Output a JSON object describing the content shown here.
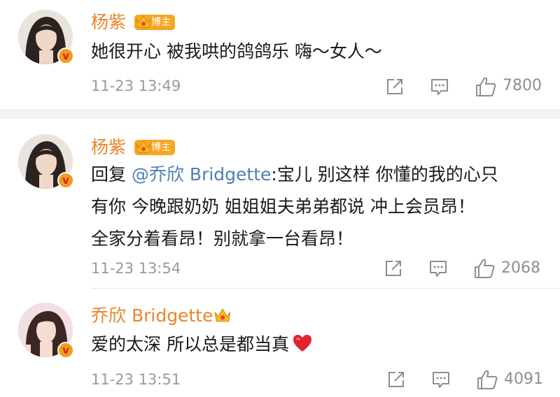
{
  "comments": [
    {
      "user": "杨紫",
      "badge": "博主",
      "text_lines": [
        "她很开心 被我哄的鸽鸽乐 嗨～女人～"
      ],
      "time": "11-23 13:49",
      "likes": "7800"
    },
    {
      "user": "杨紫",
      "badge": "博主",
      "reply_prefix": "回复",
      "mention": "@乔欣 Bridgette",
      "line1_rest": ":宝儿 别这样 你懂的我的心只",
      "line2": "有你 今晚跟奶奶 姐姐姐夫弟弟都说 冲上会员昂！",
      "line3": "全家分着看昂！别就拿一台看昂！",
      "time": "11-23 13:54",
      "likes": "2068"
    },
    {
      "user": "乔欣 Bridgette",
      "text": "爱的太深 所以总是都当真",
      "emoji": "red-heart",
      "time": "11-23 13:51",
      "likes": "4091"
    }
  ],
  "colors": {
    "username": "#e8852c",
    "mention": "#4f7fb5",
    "badge_bg": "#f6a623",
    "verify_badge": "#f29c1f",
    "meta_text": "#9a9a9a"
  },
  "icons": [
    "share-icon",
    "comment-icon",
    "like-icon",
    "crown-icon",
    "verified-badge-icon",
    "heart-icon"
  ]
}
